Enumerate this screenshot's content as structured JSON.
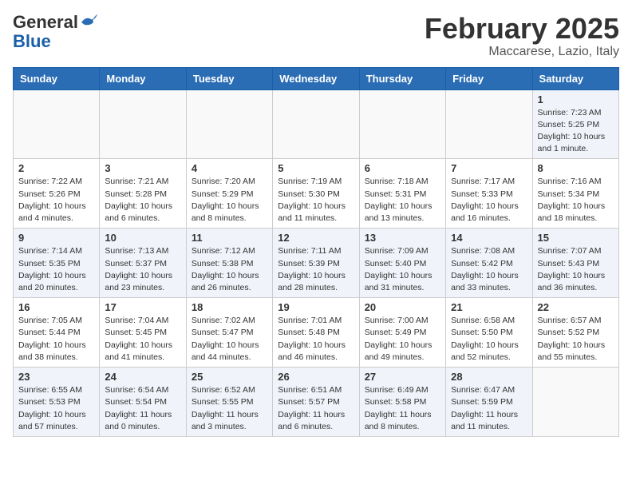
{
  "header": {
    "logo_general": "General",
    "logo_blue": "Blue",
    "month": "February 2025",
    "location": "Maccarese, Lazio, Italy"
  },
  "weekdays": [
    "Sunday",
    "Monday",
    "Tuesday",
    "Wednesday",
    "Thursday",
    "Friday",
    "Saturday"
  ],
  "weeks": [
    [
      {
        "day": "",
        "info": ""
      },
      {
        "day": "",
        "info": ""
      },
      {
        "day": "",
        "info": ""
      },
      {
        "day": "",
        "info": ""
      },
      {
        "day": "",
        "info": ""
      },
      {
        "day": "",
        "info": ""
      },
      {
        "day": "1",
        "info": "Sunrise: 7:23 AM\nSunset: 5:25 PM\nDaylight: 10 hours\nand 1 minute."
      }
    ],
    [
      {
        "day": "2",
        "info": "Sunrise: 7:22 AM\nSunset: 5:26 PM\nDaylight: 10 hours\nand 4 minutes."
      },
      {
        "day": "3",
        "info": "Sunrise: 7:21 AM\nSunset: 5:28 PM\nDaylight: 10 hours\nand 6 minutes."
      },
      {
        "day": "4",
        "info": "Sunrise: 7:20 AM\nSunset: 5:29 PM\nDaylight: 10 hours\nand 8 minutes."
      },
      {
        "day": "5",
        "info": "Sunrise: 7:19 AM\nSunset: 5:30 PM\nDaylight: 10 hours\nand 11 minutes."
      },
      {
        "day": "6",
        "info": "Sunrise: 7:18 AM\nSunset: 5:31 PM\nDaylight: 10 hours\nand 13 minutes."
      },
      {
        "day": "7",
        "info": "Sunrise: 7:17 AM\nSunset: 5:33 PM\nDaylight: 10 hours\nand 16 minutes."
      },
      {
        "day": "8",
        "info": "Sunrise: 7:16 AM\nSunset: 5:34 PM\nDaylight: 10 hours\nand 18 minutes."
      }
    ],
    [
      {
        "day": "9",
        "info": "Sunrise: 7:14 AM\nSunset: 5:35 PM\nDaylight: 10 hours\nand 20 minutes."
      },
      {
        "day": "10",
        "info": "Sunrise: 7:13 AM\nSunset: 5:37 PM\nDaylight: 10 hours\nand 23 minutes."
      },
      {
        "day": "11",
        "info": "Sunrise: 7:12 AM\nSunset: 5:38 PM\nDaylight: 10 hours\nand 26 minutes."
      },
      {
        "day": "12",
        "info": "Sunrise: 7:11 AM\nSunset: 5:39 PM\nDaylight: 10 hours\nand 28 minutes."
      },
      {
        "day": "13",
        "info": "Sunrise: 7:09 AM\nSunset: 5:40 PM\nDaylight: 10 hours\nand 31 minutes."
      },
      {
        "day": "14",
        "info": "Sunrise: 7:08 AM\nSunset: 5:42 PM\nDaylight: 10 hours\nand 33 minutes."
      },
      {
        "day": "15",
        "info": "Sunrise: 7:07 AM\nSunset: 5:43 PM\nDaylight: 10 hours\nand 36 minutes."
      }
    ],
    [
      {
        "day": "16",
        "info": "Sunrise: 7:05 AM\nSunset: 5:44 PM\nDaylight: 10 hours\nand 38 minutes."
      },
      {
        "day": "17",
        "info": "Sunrise: 7:04 AM\nSunset: 5:45 PM\nDaylight: 10 hours\nand 41 minutes."
      },
      {
        "day": "18",
        "info": "Sunrise: 7:02 AM\nSunset: 5:47 PM\nDaylight: 10 hours\nand 44 minutes."
      },
      {
        "day": "19",
        "info": "Sunrise: 7:01 AM\nSunset: 5:48 PM\nDaylight: 10 hours\nand 46 minutes."
      },
      {
        "day": "20",
        "info": "Sunrise: 7:00 AM\nSunset: 5:49 PM\nDaylight: 10 hours\nand 49 minutes."
      },
      {
        "day": "21",
        "info": "Sunrise: 6:58 AM\nSunset: 5:50 PM\nDaylight: 10 hours\nand 52 minutes."
      },
      {
        "day": "22",
        "info": "Sunrise: 6:57 AM\nSunset: 5:52 PM\nDaylight: 10 hours\nand 55 minutes."
      }
    ],
    [
      {
        "day": "23",
        "info": "Sunrise: 6:55 AM\nSunset: 5:53 PM\nDaylight: 10 hours\nand 57 minutes."
      },
      {
        "day": "24",
        "info": "Sunrise: 6:54 AM\nSunset: 5:54 PM\nDaylight: 11 hours\nand 0 minutes."
      },
      {
        "day": "25",
        "info": "Sunrise: 6:52 AM\nSunset: 5:55 PM\nDaylight: 11 hours\nand 3 minutes."
      },
      {
        "day": "26",
        "info": "Sunrise: 6:51 AM\nSunset: 5:57 PM\nDaylight: 11 hours\nand 6 minutes."
      },
      {
        "day": "27",
        "info": "Sunrise: 6:49 AM\nSunset: 5:58 PM\nDaylight: 11 hours\nand 8 minutes."
      },
      {
        "day": "28",
        "info": "Sunrise: 6:47 AM\nSunset: 5:59 PM\nDaylight: 11 hours\nand 11 minutes."
      },
      {
        "day": "",
        "info": ""
      }
    ]
  ]
}
